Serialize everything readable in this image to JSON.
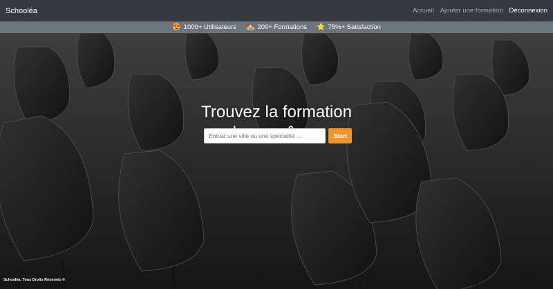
{
  "nav": {
    "brand": "Schooléa",
    "links": [
      {
        "label": "Accueil",
        "active": false
      },
      {
        "label": "Ajouter une formation",
        "active": false
      },
      {
        "label": "Déconnexion",
        "active": true
      }
    ]
  },
  "stats": [
    {
      "icon": "😍",
      "label": "1000+ Utilisateurs"
    },
    {
      "icon": "🏫",
      "label": "200+ Formations"
    },
    {
      "icon": "⭐",
      "label": "75%+ Satisfaction"
    }
  ],
  "hero": {
    "title_line1": "Trouvez la formation",
    "title_line2": "de vos rêves.",
    "search_placeholder": "Entrez une ville ou une spécialité ...",
    "search_value": "",
    "button_label": "Start"
  },
  "footer": {
    "text": "Schooléa. Tous Droits Réservés ©"
  },
  "colors": {
    "navbar": "#343a40",
    "statsbar": "#6c757d",
    "accent": "#f0952d"
  }
}
